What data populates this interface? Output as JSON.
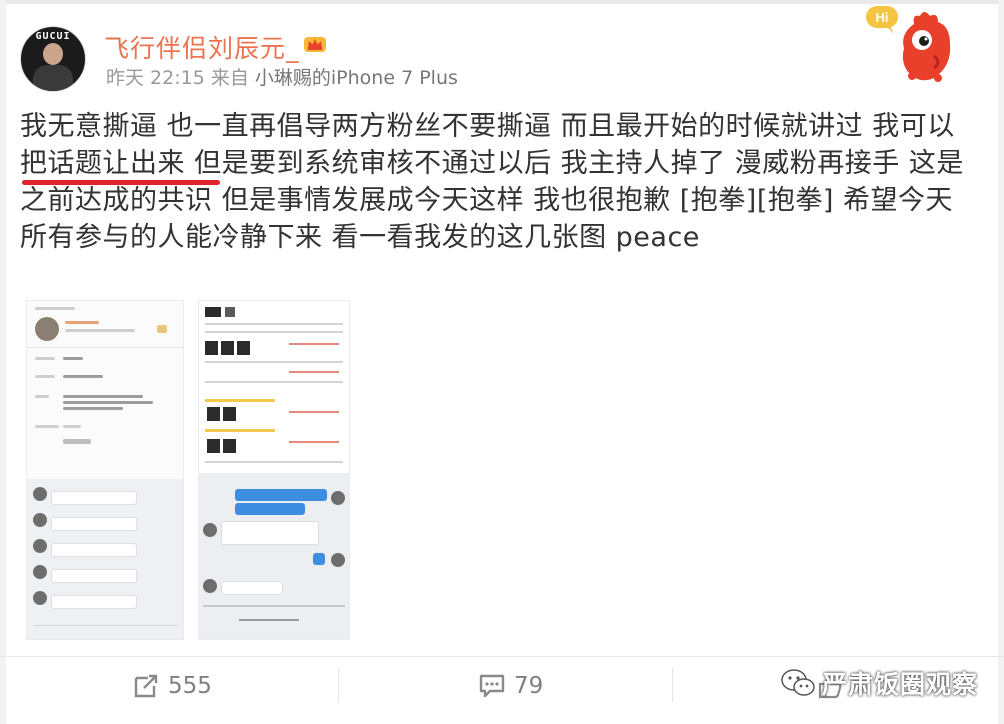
{
  "post": {
    "username": "飞行伴侣刘辰元_",
    "time": "昨天 22:15",
    "from_label": "来自",
    "device": "小琳赐的iPhone 7 Plus",
    "avatar_cap_text": "GUCUI",
    "content": "我无意撕逼 也一直再倡导两方粉丝不要撕逼 而且最开始的时候就讲过 我可以把话题让出来 但是要到系统审核不通过以后 我主持人掉了 漫威粉再接手 这是之前达成的共识 但是事情发展成今天这样 我也很抱歉 [抱拳][抱拳] 希望今天所有参与的人能冷静下来 看一看我发的这几张图 peace"
  },
  "mascot": {
    "bubble_text": "Hi",
    "icon": "red-mascot-icon"
  },
  "badges": {
    "vip_icon": "crown-vip-icon"
  },
  "actions": {
    "repost_count": "555",
    "comment_count": "79",
    "like_count": ""
  },
  "watermark": {
    "text": "严肃饭圈观察",
    "icon": "wechat-icon"
  },
  "colors": {
    "username": "#eb7350",
    "underline": "#e0232b",
    "meta": "#999999",
    "action_text": "#808080"
  }
}
